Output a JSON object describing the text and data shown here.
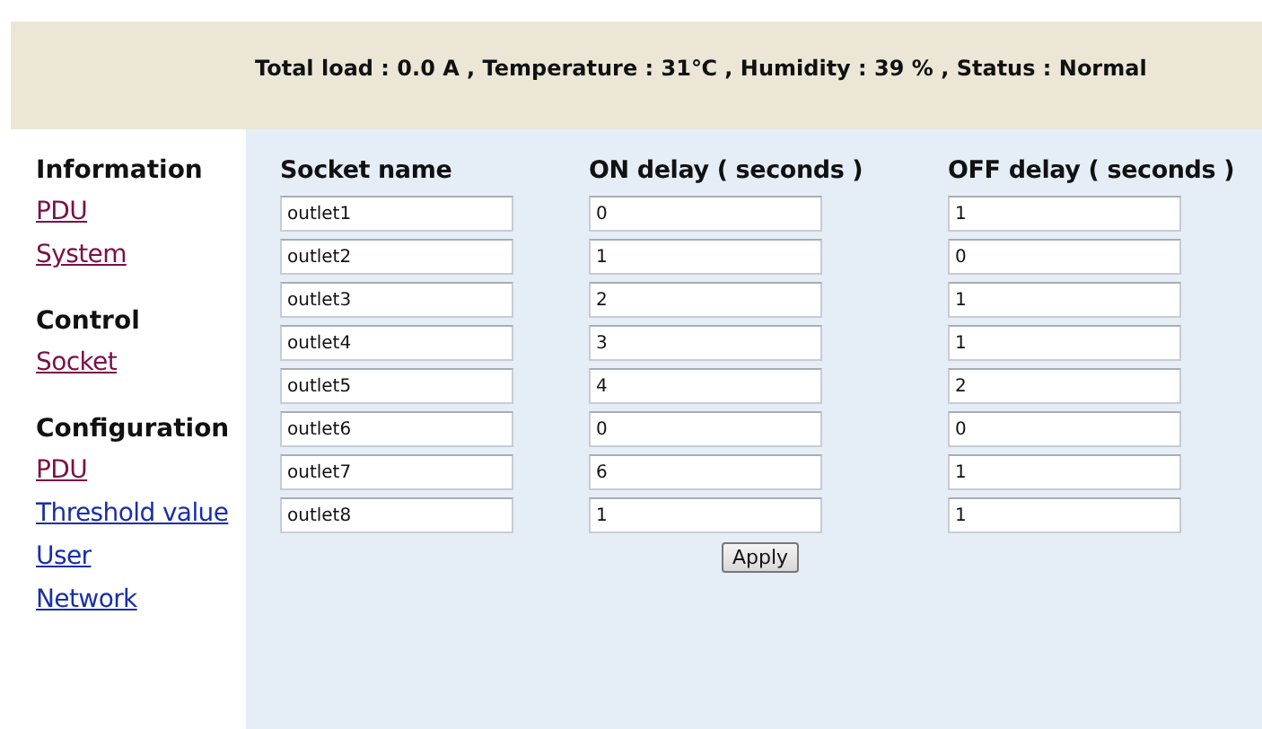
{
  "status_bar": {
    "text": "Total load : 0.0 A ,  Temperature : 31℃ ,  Humidity : 39 % , Status : Normal"
  },
  "sidebar": {
    "sections": [
      {
        "heading": "Information",
        "links": [
          {
            "label": "PDU",
            "visited": true
          },
          {
            "label": "System",
            "visited": true
          }
        ]
      },
      {
        "heading": "Control",
        "links": [
          {
            "label": "Socket",
            "visited": true
          }
        ]
      },
      {
        "heading": "Configuration",
        "links": [
          {
            "label": "PDU",
            "visited": true
          },
          {
            "label": "Threshold value",
            "visited": false
          },
          {
            "label": "User",
            "visited": false
          },
          {
            "label": "Network",
            "visited": false
          }
        ]
      }
    ]
  },
  "table": {
    "columns": [
      "Socket name",
      "ON delay ( seconds )",
      "OFF delay ( seconds )"
    ],
    "rows": [
      [
        "outlet1",
        "0",
        "1"
      ],
      [
        "outlet2",
        "1",
        "0"
      ],
      [
        "outlet3",
        "2",
        "1"
      ],
      [
        "outlet4",
        "3",
        "1"
      ],
      [
        "outlet5",
        "4",
        "2"
      ],
      [
        "outlet6",
        "0",
        "0"
      ],
      [
        "outlet7",
        "6",
        "1"
      ],
      [
        "outlet8",
        "1",
        "1"
      ]
    ]
  },
  "buttons": [
    "Apply"
  ]
}
